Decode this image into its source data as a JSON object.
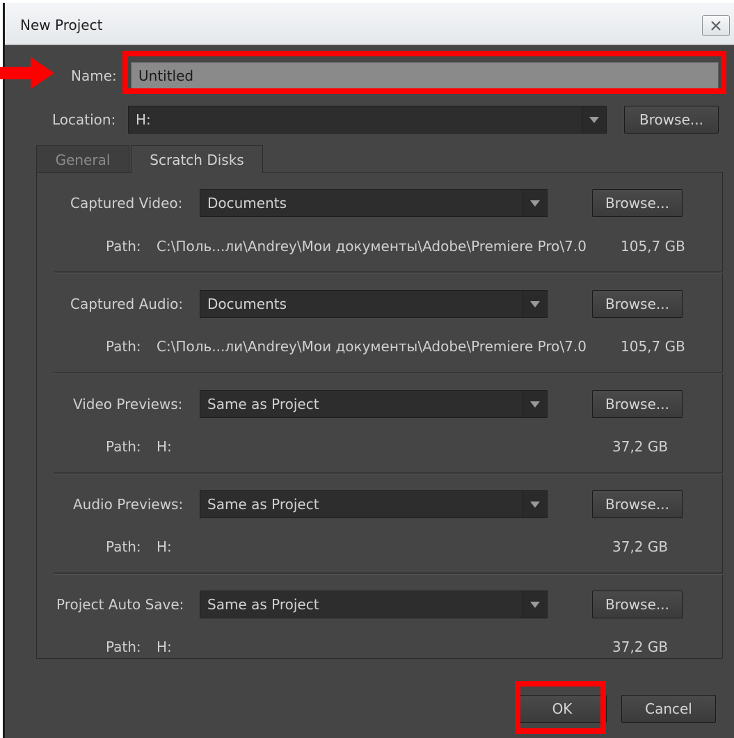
{
  "window": {
    "title": "New Project"
  },
  "name": {
    "label": "Name:",
    "value": "Untitled"
  },
  "location": {
    "label": "Location:",
    "value": "H:",
    "browse": "Browse..."
  },
  "tabs": [
    {
      "label": "General",
      "active": false
    },
    {
      "label": "Scratch Disks",
      "active": true
    }
  ],
  "path_label": "Path:",
  "rows": [
    {
      "label": "Captured Video:",
      "value": "Documents",
      "browse": "Browse...",
      "path": "C:\\Поль...ли\\Andrey\\Мои документы\\Adobe\\Premiere Pro\\7.0",
      "size": "105,7 GB"
    },
    {
      "label": "Captured Audio:",
      "value": "Documents",
      "browse": "Browse...",
      "path": "C:\\Поль...ли\\Andrey\\Мои документы\\Adobe\\Premiere Pro\\7.0",
      "size": "105,7 GB"
    },
    {
      "label": "Video Previews:",
      "value": "Same as Project",
      "browse": "Browse...",
      "path": "H:",
      "size": "37,2 GB"
    },
    {
      "label": "Audio Previews:",
      "value": "Same as Project",
      "browse": "Browse...",
      "path": "H:",
      "size": "37,2 GB"
    },
    {
      "label": "Project Auto Save:",
      "value": "Same as Project",
      "browse": "Browse...",
      "path": "H:",
      "size": "37,2 GB"
    }
  ],
  "buttons": {
    "ok": "OK",
    "cancel": "Cancel"
  },
  "colors": {
    "dialog_bg": "#454545",
    "highlight": "#ff0000"
  }
}
